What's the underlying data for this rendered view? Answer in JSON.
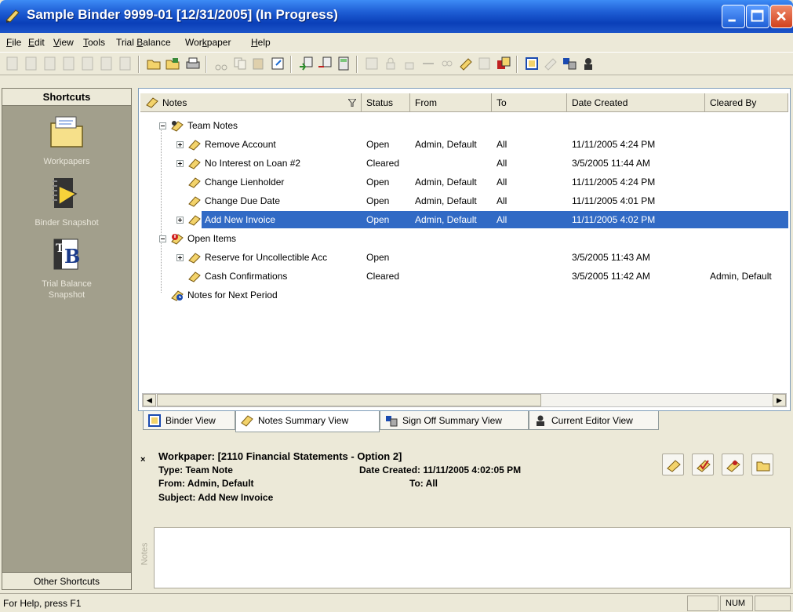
{
  "window": {
    "title": "Sample Binder 9999-01 [12/31/2005] (In Progress)"
  },
  "menu": [
    {
      "pre": "",
      "u": "F",
      "post": "ile"
    },
    {
      "pre": "",
      "u": "E",
      "post": "dit"
    },
    {
      "pre": "",
      "u": "V",
      "post": "iew"
    },
    {
      "pre": "",
      "u": "T",
      "post": "ools"
    },
    {
      "pre": "Trial ",
      "u": "B",
      "post": "alance"
    },
    {
      "pre": "Wor",
      "u": "k",
      "post": "paper"
    },
    {
      "pre": "",
      "u": "H",
      "post": "elp"
    }
  ],
  "shortcuts": {
    "header": "Shortcuts",
    "footer": "Other Shortcuts",
    "items": [
      {
        "label": "Workpapers",
        "icon": "folder-icon"
      },
      {
        "label": "Binder Snapshot",
        "icon": "binder-snapshot-icon"
      },
      {
        "label": "Trial Balance Snapshot",
        "label_line1": "Trial Balance",
        "label_line2": "Snapshot",
        "icon": "trial-balance-icon"
      }
    ]
  },
  "notes_list": {
    "columns": [
      "Notes",
      "Status",
      "From",
      "To",
      "Date Created",
      "Cleared By"
    ],
    "rows": [
      {
        "name": "Team Notes",
        "status": "",
        "from": "",
        "to": "",
        "date": "",
        "cleared": ""
      },
      {
        "name": "Remove Account",
        "status": "Open",
        "from": "Admin, Default",
        "to": "All",
        "date": "11/11/2005 4:24 PM",
        "cleared": ""
      },
      {
        "name": "No Interest on Loan #2",
        "status": "Cleared",
        "from": "",
        "to": "All",
        "date": "3/5/2005 11:44 AM",
        "cleared": ""
      },
      {
        "name": "Change Lienholder",
        "status": "Open",
        "from": "Admin, Default",
        "to": "All",
        "date": "11/11/2005 4:24 PM",
        "cleared": ""
      },
      {
        "name": "Change Due Date",
        "status": "Open",
        "from": "Admin, Default",
        "to": "All",
        "date": "11/11/2005 4:01 PM",
        "cleared": ""
      },
      {
        "name": "Add New Invoice",
        "status": "Open",
        "from": "Admin, Default",
        "to": "All",
        "date": "11/11/2005 4:02 PM",
        "cleared": ""
      },
      {
        "name": "Open Items",
        "status": "",
        "from": "",
        "to": "",
        "date": "",
        "cleared": ""
      },
      {
        "name": "Reserve for Uncollectible Acc",
        "status": "Open",
        "from": "",
        "to": "",
        "date": "3/5/2005 11:43 AM",
        "cleared": ""
      },
      {
        "name": "Cash Confirmations",
        "status": "Cleared",
        "from": "",
        "to": "",
        "date": "3/5/2005 11:42 AM",
        "cleared": "Admin, Default"
      },
      {
        "name": "Notes for Next Period",
        "status": "",
        "from": "",
        "to": "",
        "date": "",
        "cleared": ""
      }
    ]
  },
  "tabs": [
    "Binder View",
    "Notes Summary View",
    "Sign Off Summary View",
    "Current Editor View"
  ],
  "detail": {
    "workpaper": "Workpaper: [2110 Financial Statements - Option 2]",
    "type": "Type: Team Note",
    "date_created": "Date Created: 11/11/2005 4:02:05 PM",
    "from": "From: Admin, Default",
    "to": "To: All",
    "subject": "Subject: Add New Invoice",
    "side_label": "Notes",
    "close_glyph": "×"
  },
  "statusbar": {
    "help": "For Help, press F1",
    "num": "NUM"
  },
  "colors": {
    "selection": "#316ac5",
    "titlebar": "#0a3fb8",
    "shortcuts_bg": "#a29f8c"
  }
}
